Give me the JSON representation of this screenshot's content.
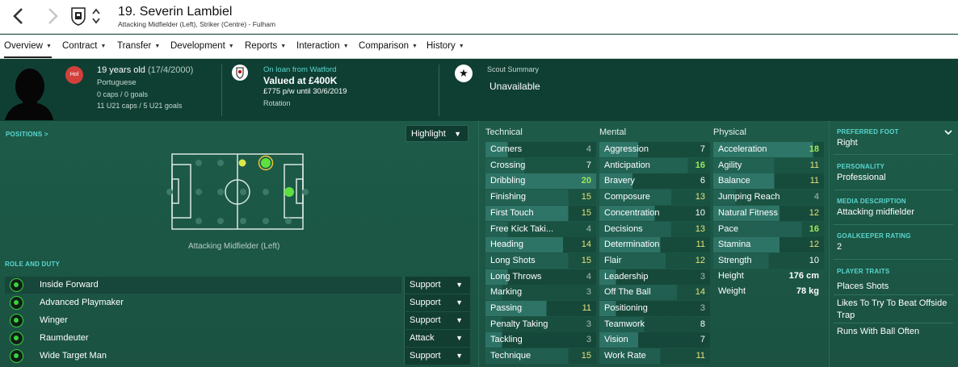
{
  "header": {
    "number_name": "19. Severin Lambiel",
    "subtitle": "Attacking Midfielder (Left), Striker (Centre) - Fulham"
  },
  "tabs": [
    {
      "label": "Overview"
    },
    {
      "label": "Contract"
    },
    {
      "label": "Transfer"
    },
    {
      "label": "Development"
    },
    {
      "label": "Reports"
    },
    {
      "label": "Interaction"
    },
    {
      "label": "Comparison"
    },
    {
      "label": "History"
    }
  ],
  "info": {
    "age": "19 years old",
    "dob": "(17/4/2000)",
    "nationality": "Portuguese",
    "flag_code": "Hol",
    "caps": "0 caps / 0 goals",
    "u21": "11 U21 caps / 5 U21 goals"
  },
  "loan": {
    "title": "On loan from Watford",
    "value": "Valued at £400K",
    "wage": "£775 p/w until 30/6/2019",
    "status": "Rotation"
  },
  "scout": {
    "title": "Scout Summary",
    "value": "Unavailable"
  },
  "positions": {
    "label": "POSITIONS >",
    "highlight": "Highlight",
    "position_name": "Attacking Midfielder (Left)"
  },
  "roles": {
    "label": "ROLE AND DUTY",
    "items": [
      {
        "name": "Inside Forward",
        "duty": "Support"
      },
      {
        "name": "Advanced Playmaker",
        "duty": "Support"
      },
      {
        "name": "Winger",
        "duty": "Support"
      },
      {
        "name": "Raumdeuter",
        "duty": "Attack"
      },
      {
        "name": "Wide Target Man",
        "duty": "Support"
      }
    ]
  },
  "attributes": {
    "technical_title": "Technical",
    "mental_title": "Mental",
    "physical_title": "Physical",
    "technical": [
      [
        "Corners",
        "4"
      ],
      [
        "Crossing",
        "7"
      ],
      [
        "Dribbling",
        "20"
      ],
      [
        "Finishing",
        "15"
      ],
      [
        "First Touch",
        "15"
      ],
      [
        "Free Kick Taki...",
        "4"
      ],
      [
        "Heading",
        "14"
      ],
      [
        "Long Shots",
        "15"
      ],
      [
        "Long Throws",
        "4"
      ],
      [
        "Marking",
        "3"
      ],
      [
        "Passing",
        "11"
      ],
      [
        "Penalty Taking",
        "3"
      ],
      [
        "Tackling",
        "3"
      ],
      [
        "Technique",
        "15"
      ]
    ],
    "mental": [
      [
        "Aggression",
        "7"
      ],
      [
        "Anticipation",
        "16"
      ],
      [
        "Bravery",
        "6"
      ],
      [
        "Composure",
        "13"
      ],
      [
        "Concentration",
        "10"
      ],
      [
        "Decisions",
        "13"
      ],
      [
        "Determination",
        "11"
      ],
      [
        "Flair",
        "12"
      ],
      [
        "Leadership",
        "3"
      ],
      [
        "Off The Ball",
        "14"
      ],
      [
        "Positioning",
        "3"
      ],
      [
        "Teamwork",
        "8"
      ],
      [
        "Vision",
        "7"
      ],
      [
        "Work Rate",
        "11"
      ]
    ],
    "physical": [
      [
        "Acceleration",
        "18"
      ],
      [
        "Agility",
        "11"
      ],
      [
        "Balance",
        "11"
      ],
      [
        "Jumping Reach",
        "4"
      ],
      [
        "Natural Fitness",
        "12"
      ],
      [
        "Pace",
        "16"
      ],
      [
        "Stamina",
        "12"
      ],
      [
        "Strength",
        "10"
      ]
    ],
    "height_label": "Height",
    "height": "176 cm",
    "weight_label": "Weight",
    "weight": "78 kg"
  },
  "sidebar": {
    "foot_label": "PREFERRED FOOT",
    "foot": "Right",
    "personality_label": "PERSONALITY",
    "personality": "Professional",
    "media_label": "MEDIA DESCRIPTION",
    "media": "Attacking midfielder",
    "gk_label": "GOALKEEPER RATING",
    "gk": "2",
    "traits_label": "PLAYER TRAITS",
    "traits": [
      "Places Shots",
      "Likes To Try To Beat Offside Trap",
      "Runs With Ball Often"
    ]
  },
  "colors": {
    "accent": "#59d7d0",
    "green": "#9ee85a",
    "yellow": "#e8e27a",
    "panel": "#1c5443"
  }
}
